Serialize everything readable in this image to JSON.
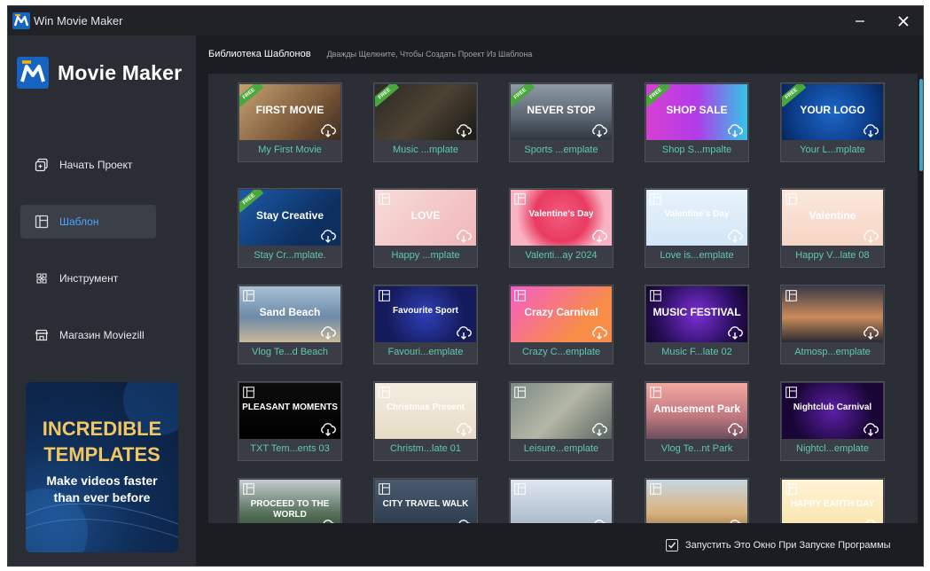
{
  "window": {
    "title": "Win Movie Maker",
    "app_icon": "movie-maker-logo-icon",
    "minimize_icon": "minimize-icon",
    "close_icon": "close-icon"
  },
  "sidebar": {
    "brand": "Movie Maker",
    "items": [
      {
        "label": "Начать Проект",
        "icon": "new-project-icon",
        "active": false
      },
      {
        "label": "Шаблон",
        "icon": "template-icon",
        "active": true
      },
      {
        "label": "Инструмент",
        "icon": "tool-icon",
        "active": false
      },
      {
        "label": "Магазин Moviezill",
        "icon": "store-icon",
        "active": false
      }
    ],
    "promo": {
      "line1": "INCREDIBLE",
      "line2": "TEMPLATES",
      "sub1": "Make videos faster",
      "sub2": "than ever before"
    }
  },
  "main": {
    "title": "Библиотека Шаблонов",
    "hint": "Дважды Щелкните, Чтобы Создать Проект Из Шаблона"
  },
  "templates": [
    {
      "label": "My First Movie",
      "badge": "FREE",
      "thumb": "FIRST MOVIE",
      "bg": "linear-gradient(135deg,#c5a273,#7d5a3a 60%,#3e2c1f)"
    },
    {
      "label": "Music ...mplate",
      "badge": "FREE",
      "thumb": "",
      "bg": "linear-gradient(135deg,#2b2a25,#4d4233 50%,#1a1915)"
    },
    {
      "label": "Sports ...emplate",
      "badge": "FREE",
      "thumb": "NEVER STOP",
      "bg": "linear-gradient(180deg,#8e9aa6,#596470 60%,#2f3740)"
    },
    {
      "label": "Shop S...mpalte",
      "badge": "FREE",
      "thumb": "SHOP SALE",
      "bg": "linear-gradient(90deg,#d73fd3,#b13be8 50%,#34c6e8)"
    },
    {
      "label": "Your L...mplate",
      "badge": "FREE",
      "thumb": "YOUR LOGO",
      "bg": "radial-gradient(circle at 50% 50%,#1d66c8,#0b3b86 70%,#072558)"
    },
    {
      "label": "Stay Cr...mplate.",
      "badge": "FREE",
      "thumb": "Stay Creative",
      "bg": "linear-gradient(135deg,#1c5aa8,#0d2f60 70%)"
    },
    {
      "label": "Happy ...mplate",
      "badge": "TPL",
      "thumb": "LOVE",
      "bg": "linear-gradient(135deg,#f6dcd8,#f0b6b8)"
    },
    {
      "label": "Valenti...ay 2024",
      "badge": "TPL",
      "thumb": "Valentine's Day",
      "bg": "radial-gradient(circle at 50% 45%,#f35b7d,#e83b61 45%,#f9b3c3 75%)"
    },
    {
      "label": "Love is...emplate",
      "badge": "TPL",
      "thumb": "Valentine's Day",
      "bg": "linear-gradient(180deg,#e8f2fb,#d2e6f6)"
    },
    {
      "label": "Happy V...late 08",
      "badge": "TPL",
      "thumb": "Valentine",
      "bg": "linear-gradient(180deg,#fbe8dc,#f6d5c4)"
    },
    {
      "label": "Vlog Te...d Beach",
      "badge": "TPL",
      "thumb": "Sand Beach",
      "bg": "linear-gradient(180deg,#a8c0d6,#6d8aa6 55%,#c9b89b)"
    },
    {
      "label": "Favouri...emplate",
      "badge": "TPL",
      "thumb": "Favourite Sport",
      "bg": "radial-gradient(circle at 50% 50%,#2f3fb6,#141a5a 70%)"
    },
    {
      "label": "Crazy C...emplate",
      "badge": "TPL",
      "thumb": "Crazy Carnival",
      "bg": "linear-gradient(135deg,#f65cc8,#f78d48 70%)"
    },
    {
      "label": "Music F...late 02",
      "badge": "TPL",
      "thumb": "MUSIC FESTIVAL",
      "bg": "radial-gradient(circle at 50% 50%,#7a2fd6,#2b0f5e 65%,#120629)"
    },
    {
      "label": "Atmosp...emplate",
      "badge": "TPL",
      "thumb": "",
      "bg": "linear-gradient(180deg,#3c3a48,#c98b5a 55%,#2c2a30)"
    },
    {
      "label": "TXT Tem...ents 03",
      "badge": "TPL",
      "thumb": "PLEASANT MOMENTS",
      "bg": "linear-gradient(180deg,#0c0c0c,#000000)"
    },
    {
      "label": "Christm...late 01",
      "badge": "TPL",
      "thumb": "Christmas Present",
      "bg": "linear-gradient(180deg,#f4ede0,#e7dcc6)"
    },
    {
      "label": "Leisure...emplate",
      "badge": "TPL",
      "thumb": "",
      "bg": "linear-gradient(135deg,#7a8a83,#b4b7a6 50%,#5a6660)"
    },
    {
      "label": "Vlog Te...nt Park",
      "badge": "TPL",
      "thumb": "Amusement Park",
      "bg": "linear-gradient(180deg,#f3a8a0,#c07880 60%,#6a4e5c)"
    },
    {
      "label": "Nightcl...emplate",
      "badge": "TPL",
      "thumb": "Nightclub Carnival",
      "bg": "radial-gradient(circle at 50% 50%,#5c1fa6,#1a0636 70%)"
    },
    {
      "label": "",
      "badge": "TPL",
      "thumb": "PROCEED TO THE WORLD",
      "bg": "linear-gradient(180deg,#c5ccd0,#56705a 60%,#2f4632)"
    },
    {
      "label": "",
      "badge": "TPL",
      "thumb": "CITY TRAVEL WALK",
      "bg": "linear-gradient(180deg,#4a5a6e,#283648)"
    },
    {
      "label": "",
      "badge": "TPL",
      "thumb": "",
      "bg": "linear-gradient(180deg,#dfe6ef,#9eb0c4)"
    },
    {
      "label": "",
      "badge": "TPL",
      "thumb": "",
      "bg": "linear-gradient(180deg,#c5d6e4,#d9b27a 60%,#8a6a4a)"
    },
    {
      "label": "",
      "badge": "TPL",
      "thumb": "HAPPY EARTH DAY",
      "bg": "linear-gradient(180deg,#fff3d6,#f8e3a8)"
    }
  ],
  "footer": {
    "checkbox_label": "Запустить Это Окно При Запуске Программы",
    "checked": true
  },
  "colors": {
    "accent": "#4ea3ff",
    "template_label": "#5fc8b0",
    "free_badge": "#49a83b",
    "promo_gold": "#f2c761"
  }
}
